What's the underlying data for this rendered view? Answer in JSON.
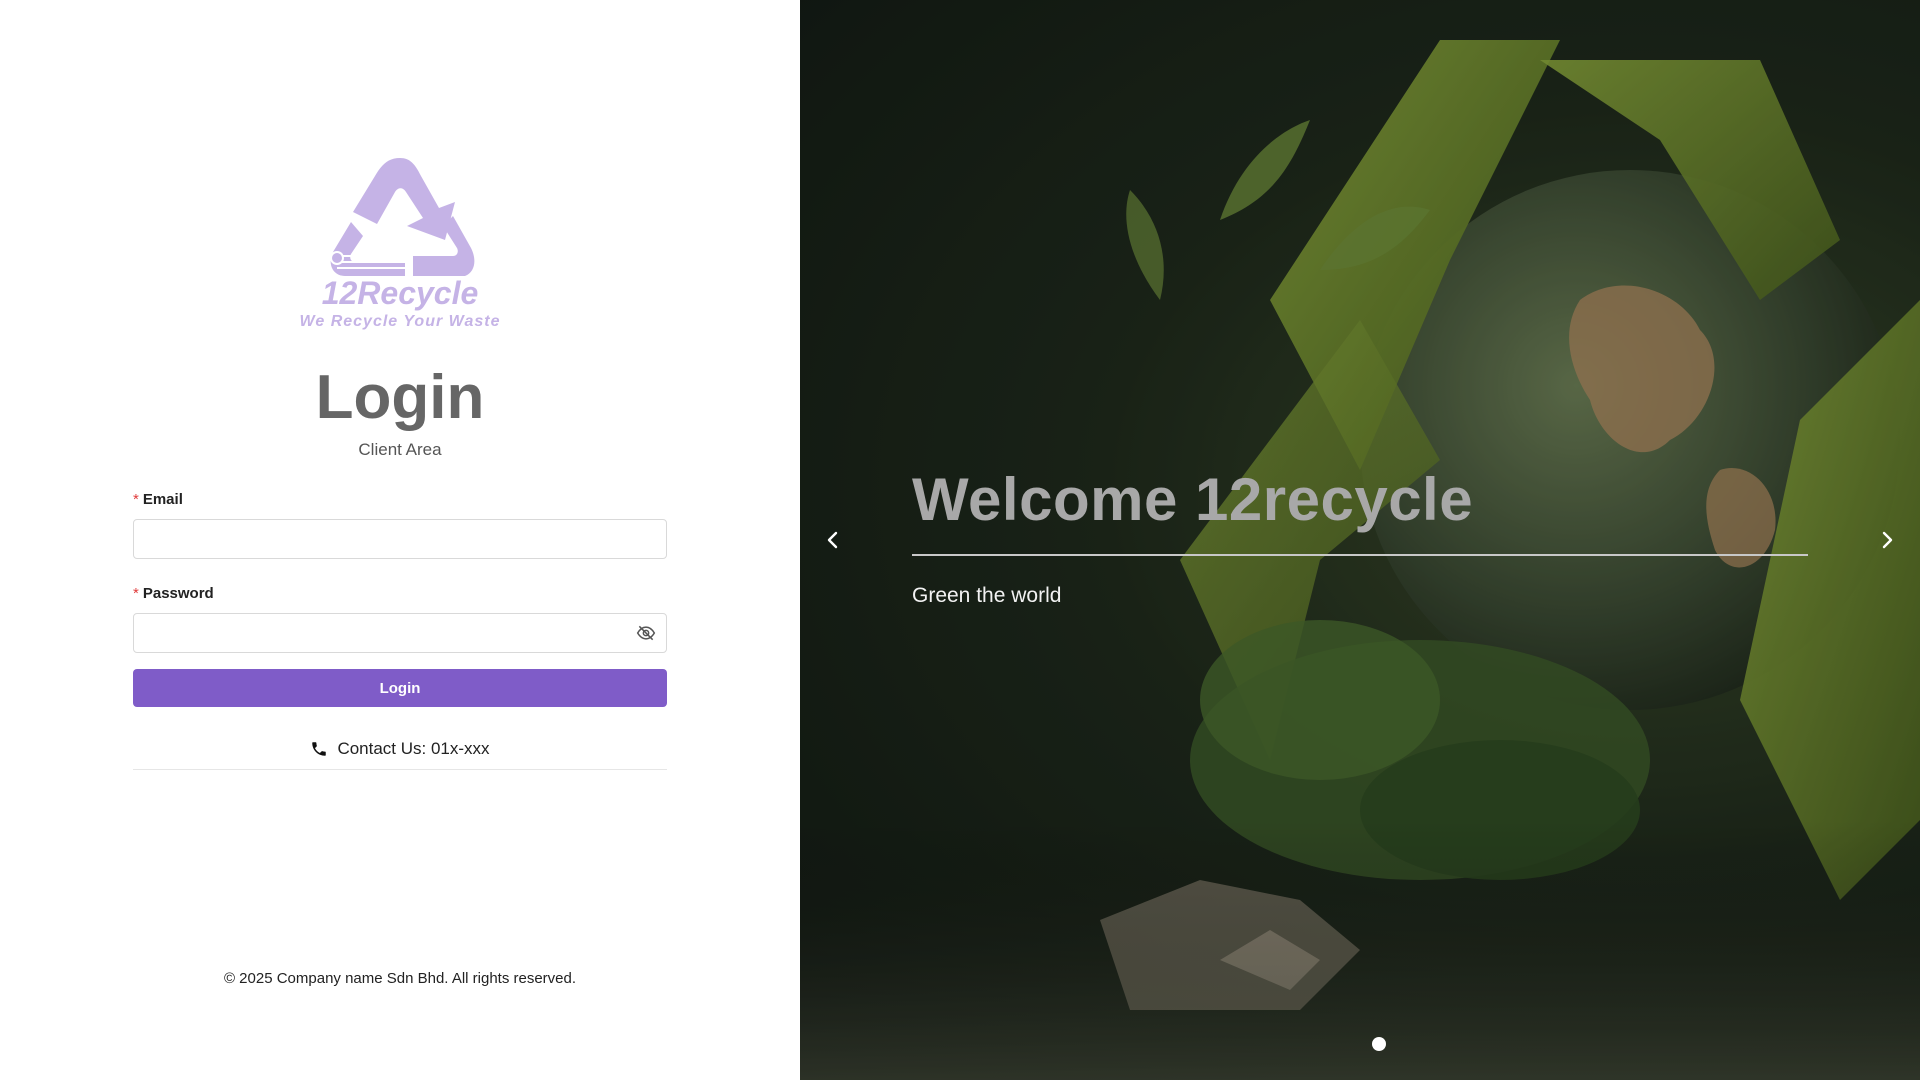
{
  "brand": {
    "logo_name": "12Recycle",
    "logo_tagline": "We Recycle Your Waste",
    "accent_color": "#7f5cc8",
    "logo_color": "#c5b3e6"
  },
  "login": {
    "title": "Login",
    "subtitle": "Client Area",
    "email_label": "Email",
    "email_value": "",
    "password_label": "Password",
    "password_value": "",
    "required_mark": "*",
    "submit_label": "Login",
    "password_toggle_icon": "eye-off-icon"
  },
  "contact": {
    "icon": "phone-icon",
    "text": "Contact Us: 01x-xxx"
  },
  "footer": {
    "text": "© 2025 Company name Sdn Bhd. All rights reserved."
  },
  "carousel": {
    "title": "Welcome 12recycle",
    "subtitle": "Green the world",
    "prev_icon": "chevron-left-icon",
    "next_icon": "chevron-right-icon",
    "slide_count": 1,
    "active_slide": 1
  }
}
